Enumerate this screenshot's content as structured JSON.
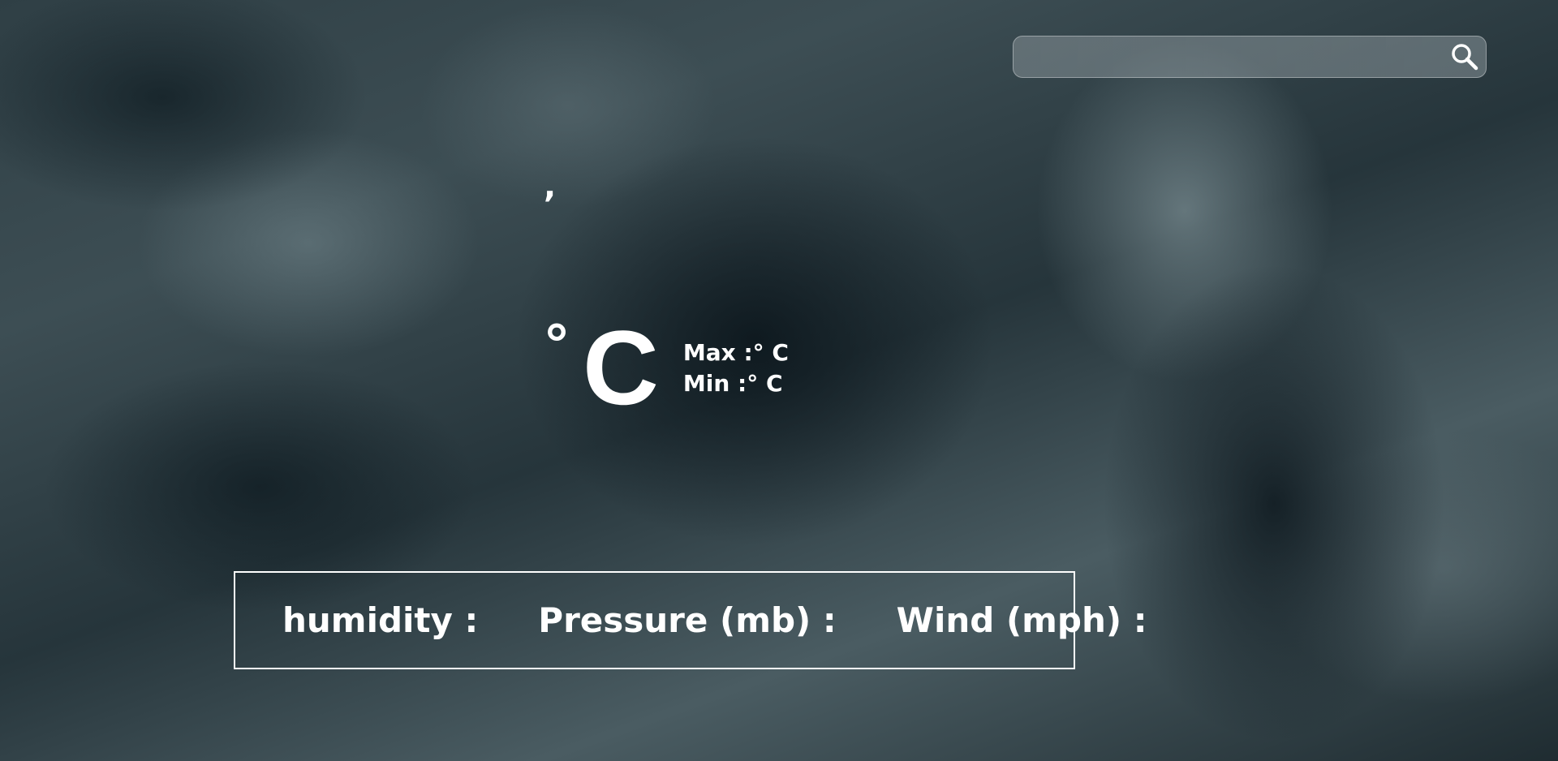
{
  "search": {
    "value": "",
    "placeholder": "",
    "icon": "search-icon"
  },
  "location": {
    "city": "",
    "separator": ",",
    "country": ""
  },
  "temperature": {
    "current": "",
    "degree_symbol": "°",
    "unit": "C",
    "max_label": "Max :",
    "max_value": "",
    "min_label": "Min :",
    "min_value": "",
    "range_unit": "° C"
  },
  "details": {
    "humidity_label": "humidity :",
    "humidity_value": "",
    "pressure_label": "Pressure (mb) :",
    "pressure_value": "",
    "wind_label": "Wind (mph) :",
    "wind_value": ""
  }
}
